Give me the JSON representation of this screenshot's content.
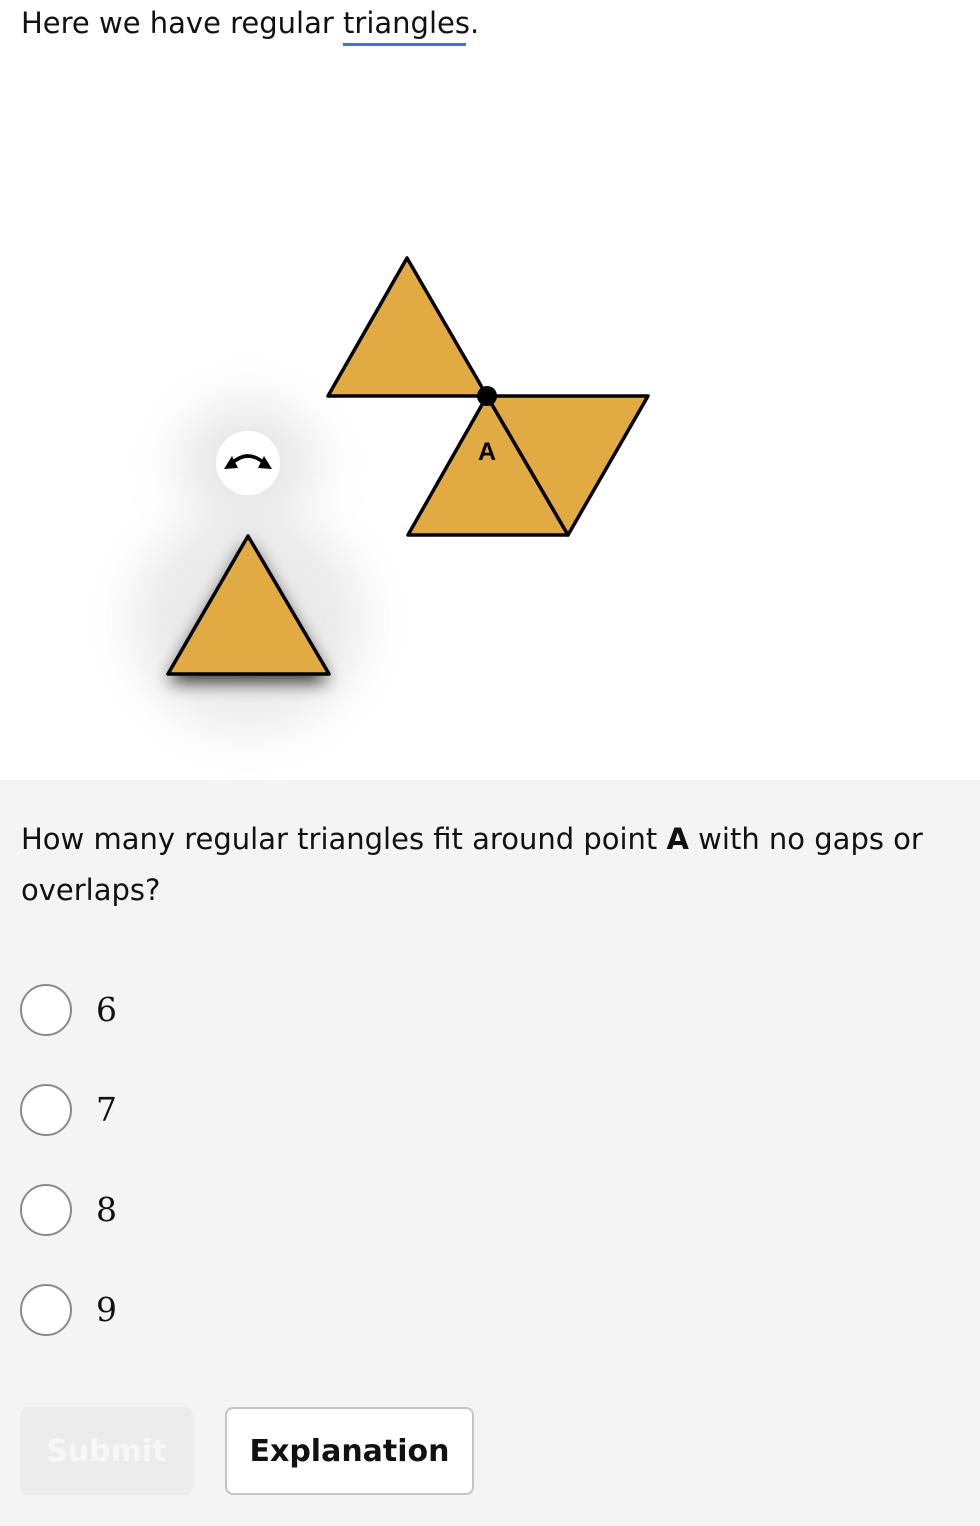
{
  "intro": {
    "prefix": "Here we have regular ",
    "term": "triangles",
    "suffix": "."
  },
  "figure": {
    "point_label": "A",
    "fill_color": "#e2aa42",
    "stroke_color": "#000000",
    "rotate_handle_icon": "rotate-arrows-icon"
  },
  "question": {
    "text_before": "How many regular triangles fit around point ",
    "point": "A",
    "text_after": " with no gaps or overlaps?"
  },
  "options": [
    {
      "label": "6"
    },
    {
      "label": "7"
    },
    {
      "label": "8"
    },
    {
      "label": "9"
    }
  ],
  "buttons": {
    "submit": "Submit",
    "explanation": "Explanation"
  }
}
